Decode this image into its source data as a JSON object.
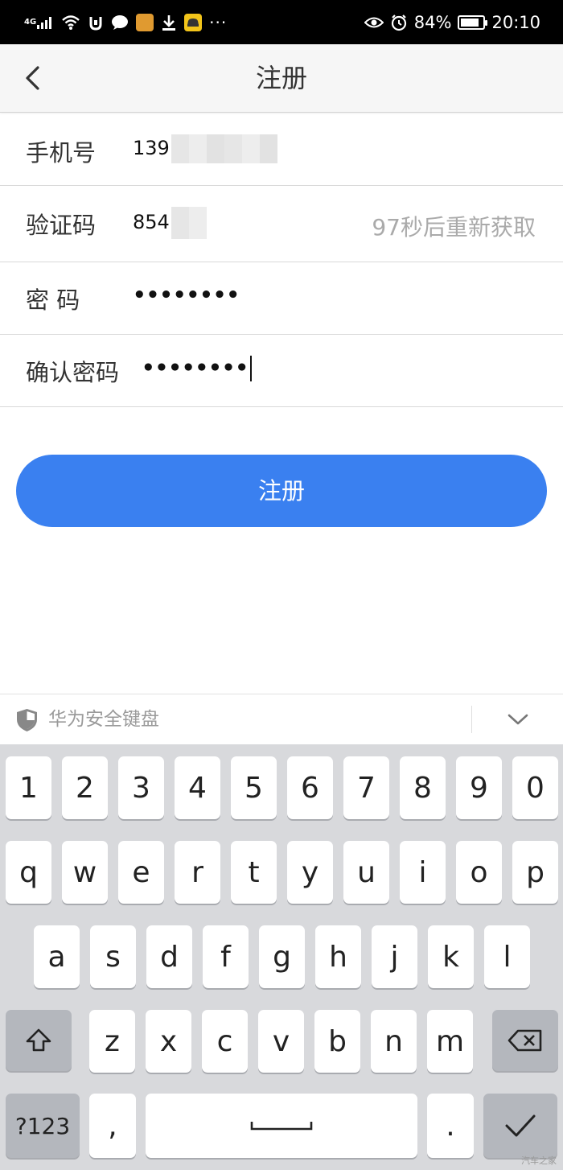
{
  "status_bar": {
    "network": "4G",
    "battery": "84%",
    "battery_level": 0.84,
    "time": "20:10",
    "icons": [
      "signal-icon",
      "wifi-icon",
      "alarm-app-icon",
      "chat-icon",
      "app-icon",
      "download-icon",
      "car-app-icon",
      "more-dots-icon",
      "eye-comfort-icon",
      "alarm-icon",
      "battery-icon"
    ]
  },
  "nav": {
    "back_icon": "chevron-left-icon",
    "title": "注册"
  },
  "form": {
    "phone": {
      "label": "手机号",
      "value": "139"
    },
    "code": {
      "label": "验证码",
      "value": "854",
      "countdown": "97秒后重新获取"
    },
    "password": {
      "label": "密 码",
      "value": "••••••••"
    },
    "confirm": {
      "label": "确认密码",
      "value": "••••••••"
    }
  },
  "submit_label": "注册",
  "keyboard": {
    "title": "华为安全键盘",
    "row1": [
      "1",
      "2",
      "3",
      "4",
      "5",
      "6",
      "7",
      "8",
      "9",
      "0"
    ],
    "row2": [
      "q",
      "w",
      "e",
      "r",
      "t",
      "y",
      "u",
      "i",
      "o",
      "p"
    ],
    "row3": [
      "a",
      "s",
      "d",
      "f",
      "g",
      "h",
      "j",
      "k",
      "l"
    ],
    "row4": [
      "z",
      "x",
      "c",
      "v",
      "b",
      "n",
      "m"
    ],
    "symbols": "?123",
    "comma": ",",
    "period": "."
  },
  "watermark": "汽车之家",
  "colors": {
    "accent": "#3a80f0",
    "keyboard_bg": "#d8d9dc",
    "dark_key": "#b4b7bd"
  }
}
